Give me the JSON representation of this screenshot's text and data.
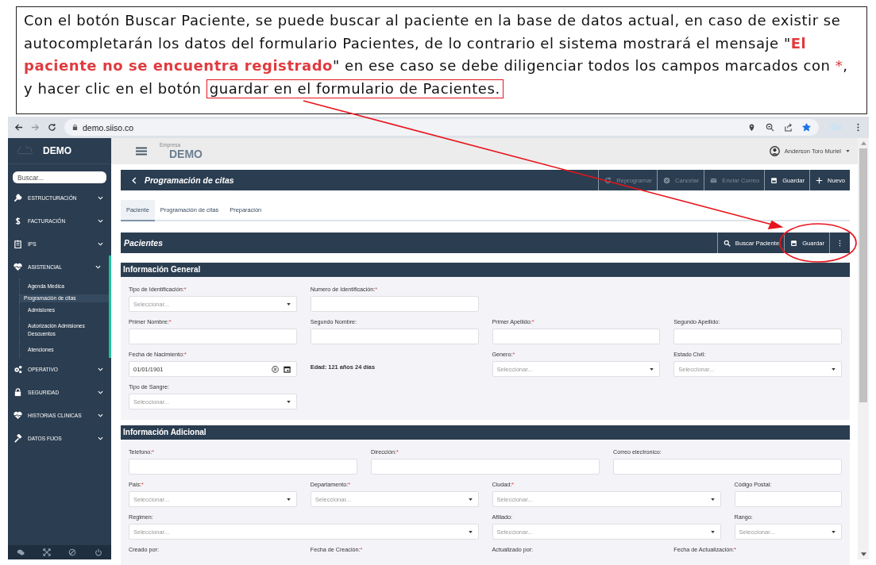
{
  "annotation": {
    "segments": [
      {
        "kind": "plain",
        "text": "Con el botón Buscar Paciente, se puede buscar al paciente en la base de datos actual, en caso de existir se autocompletarán los datos del formulario Pacientes, de lo contrario el sistema mostrará el mensaje \""
      },
      {
        "kind": "alert",
        "text": "El paciente no se encuentra registrado"
      },
      {
        "kind": "plain",
        "text": "\" en ese caso se debe diligenciar todos los campos marcados con "
      },
      {
        "kind": "mark",
        "text": "*"
      },
      {
        "kind": "plain",
        "text": ", y hacer clic en el botón "
      },
      {
        "kind": "boxed",
        "text": "guardar en el formulario de Pacientes."
      }
    ]
  },
  "browser": {
    "url": "demo.siiso.co",
    "bookmarked": true
  },
  "sidebar": {
    "brand": "DEMO",
    "search_placeholder": "Buscar...",
    "items": [
      {
        "label": "ESTRUCTURACIÓN",
        "expanded": false
      },
      {
        "label": "FACTURACIÓN",
        "expanded": false
      },
      {
        "label": "IPS",
        "expanded": false
      },
      {
        "label": "ASISTENCIAL",
        "expanded": true,
        "children": [
          {
            "label": "Agenda Medica",
            "selected": false
          },
          {
            "label": "Programación de citas",
            "selected": true
          },
          {
            "label": "Admisiones",
            "selected": false
          },
          {
            "label": "Autorización Admisiones Descuentos",
            "selected": false
          },
          {
            "label": "Atenciones",
            "selected": false
          }
        ]
      },
      {
        "label": "OPERATIVO",
        "expanded": false
      },
      {
        "label": "SEGURIDAD",
        "expanded": false
      },
      {
        "label": "HISTORIAS CLINICAS",
        "expanded": false
      },
      {
        "label": "DATOS FIJOS",
        "expanded": false
      }
    ]
  },
  "header": {
    "company_label": "Empresa",
    "company": "DEMO",
    "user": "Anderson Toro Muriel"
  },
  "page": {
    "title": "Programación de citas",
    "actions": [
      {
        "kind": "reschedule",
        "label": "Reprogramar",
        "disabled": true
      },
      {
        "kind": "cancel",
        "label": "Cancelar",
        "disabled": true
      },
      {
        "kind": "mail",
        "label": "Enviar Correo",
        "disabled": true
      },
      {
        "kind": "save",
        "label": "Guardar",
        "disabled": false
      },
      {
        "kind": "new",
        "label": "Nuevo",
        "disabled": false
      }
    ]
  },
  "tabs": [
    {
      "label": "Paciente",
      "selected": true
    },
    {
      "label": "Programación de citas",
      "selected": false
    },
    {
      "label": "Preparación",
      "selected": false
    }
  ],
  "form": {
    "title": "Pacientes",
    "actions": [
      {
        "kind": "search",
        "label": "Buscar Paciente"
      },
      {
        "kind": "save",
        "label": "Guardar"
      },
      {
        "kind": "more"
      }
    ]
  },
  "sections": [
    {
      "title": "Información General",
      "rows": [
        [
          {
            "kind": "select",
            "label": "Tipo de Identificación:",
            "required_mark": "*",
            "placeholder": "Seleccionar..."
          },
          {
            "kind": "text",
            "label": "Numero de Identificación:",
            "required_mark": "*"
          }
        ],
        [
          {
            "kind": "text",
            "label": "Primer Nombre:",
            "required_mark": "*"
          },
          {
            "kind": "text",
            "label": "Segundo Nombre:"
          },
          {
            "kind": "text",
            "label": "Primer Apellido:",
            "required_mark": "*"
          },
          {
            "kind": "text",
            "label": "Segundo Apellido:"
          }
        ],
        [
          {
            "kind": "date",
            "label": "Fecha de Nacimiento:",
            "required_mark": "*",
            "value": "01/01/1901"
          },
          {
            "kind": "info",
            "text": "Edad: 121 años 24 días"
          },
          {
            "kind": "select",
            "label": "Genero:",
            "required_mark": "*",
            "placeholder": "Seleccionar..."
          },
          {
            "kind": "select",
            "label": "Estado Civil:",
            "placeholder": "Seleccionar..."
          }
        ],
        [
          {
            "kind": "select",
            "label": "Tipo de Sangre:",
            "placeholder": "Seleccionar..."
          }
        ]
      ]
    },
    {
      "title": "Información Adicional",
      "rows": [
        [
          {
            "kind": "text",
            "label": "Telefono:",
            "required_mark": "*"
          },
          {
            "kind": "text",
            "label": "Dirección:",
            "required_mark": "*"
          },
          {
            "kind": "text",
            "label": "Correo electronico:"
          }
        ],
        [
          {
            "kind": "select",
            "label": "Pais:",
            "required_mark": "*",
            "placeholder": "Seleccionar..."
          },
          {
            "kind": "select",
            "label": "Departamento:",
            "required_mark": "*",
            "placeholder": "Seleccionar..."
          },
          {
            "kind": "select",
            "label": "Ciudad:",
            "required_mark": "*",
            "placeholder": "Seleccionar..."
          },
          {
            "kind": "text",
            "label": "Código Postal:"
          }
        ],
        [
          {
            "kind": "select",
            "label": "Regimen:",
            "placeholder": "Seleccionar..."
          },
          "",
          {
            "kind": "select",
            "label": "Afiliado:",
            "placeholder": "Seleccionar..."
          },
          {
            "kind": "select",
            "label": "Rango:",
            "placeholder": "Seleccionar..."
          }
        ],
        [
          {
            "kind": "label",
            "label": "Creado por:"
          },
          {
            "kind": "label",
            "label": "Fecha de Creación:",
            "required_mark": "*"
          },
          {
            "kind": "label",
            "label": "Actualizado por:"
          },
          {
            "kind": "label",
            "label": "Fecha de Actualización:",
            "required_mark": "*"
          }
        ]
      ]
    }
  ]
}
